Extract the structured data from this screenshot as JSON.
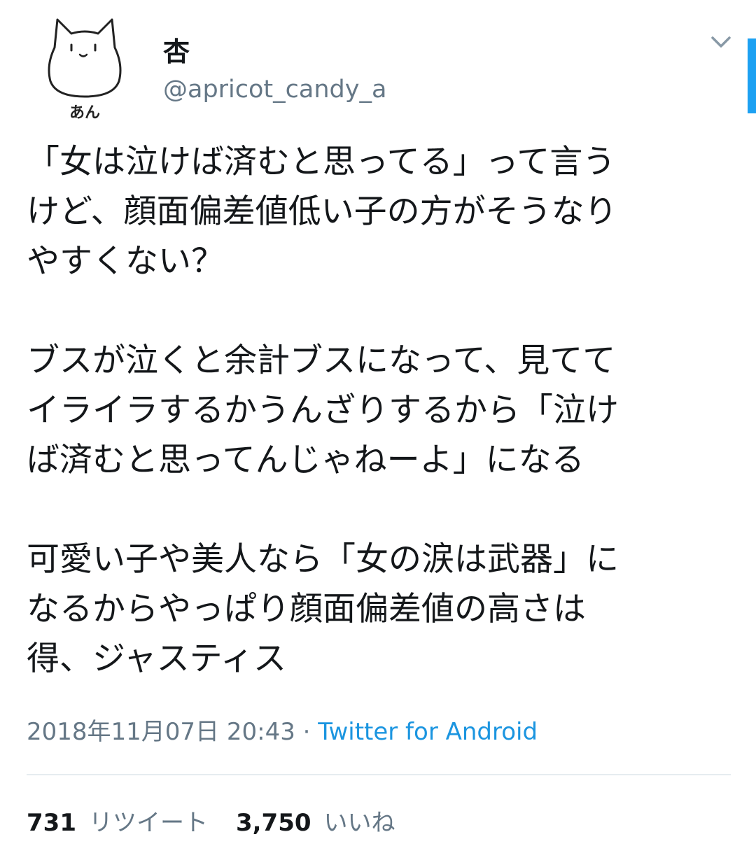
{
  "author": {
    "avatar_caption": "あん",
    "display_name": "杏",
    "handle": "@apricot_candy_a"
  },
  "tweet": {
    "paragraphs": [
      "「女は泣けば済むと思ってる」って言う\nけど、顔面偏差値低い子の方がそうなり\nやすくない？",
      "ブスが泣くと余計ブスになって、見てて\nイライラするかうんざりするから「泣け\nば済むと思ってんじゃねーよ」になる",
      "可愛い子や美人なら「女の涙は武器」に\nなるからやっぱり顔面偏差値の高さは\n得、ジャスティス"
    ],
    "timestamp": "2018年11月07日 20:43",
    "separator": " · ",
    "source": "Twitter for Android"
  },
  "stats": {
    "retweets_count": "731",
    "retweets_label": "リツイート",
    "likes_count": "3,750",
    "likes_label": "いいね"
  },
  "icons": {
    "menu": "chevron-down-icon",
    "avatar": "cat-avatar"
  },
  "colors": {
    "link": "#1b95e0",
    "secondary_text": "#657786",
    "scroll_indicator": "#1da1f2"
  }
}
